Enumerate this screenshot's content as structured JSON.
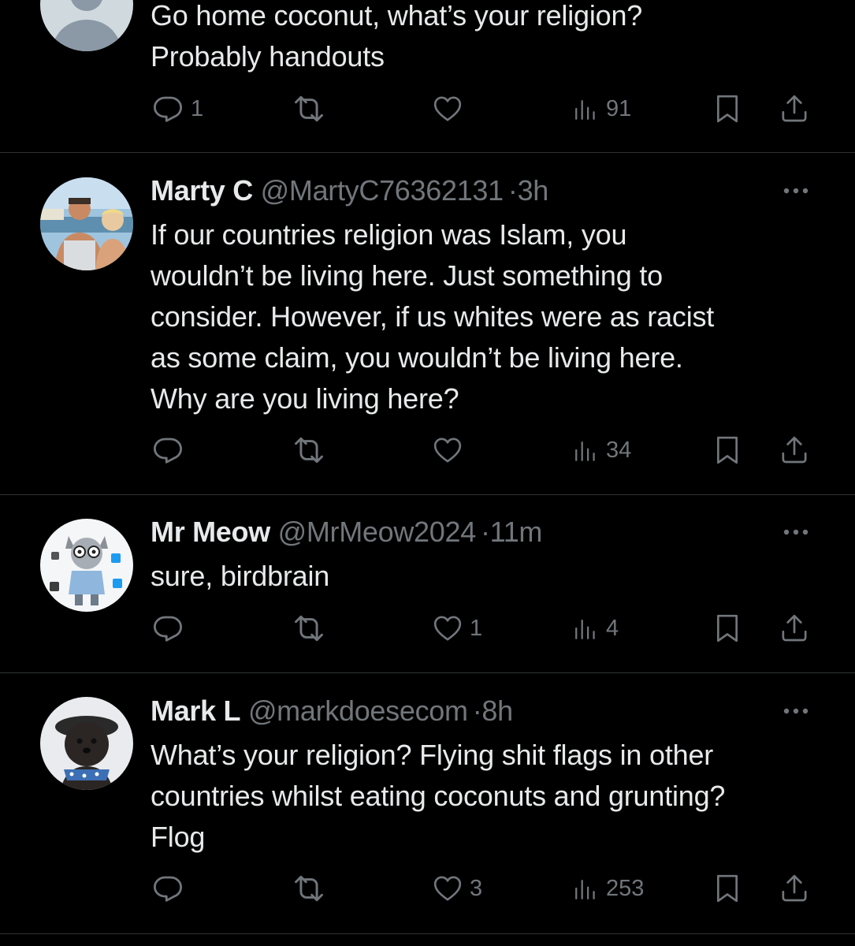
{
  "theme": {
    "background": "#000000",
    "primary_text": "#e7e9ea",
    "secondary_text": "#71767b",
    "divider": "#2f3336"
  },
  "icons": {
    "reply": "speech-bubble-icon",
    "retweet": "retweet-icon",
    "like": "heart-icon",
    "views": "bar-chart-icon",
    "bookmark": "bookmark-icon",
    "share": "share-upload-icon",
    "more": "more-dots-icon"
  },
  "tweets": [
    {
      "display_name": "",
      "text": "Go home coconut, what’s your religion?\nProbably handouts",
      "replies": "1",
      "retweets": "",
      "likes": "",
      "views": "91"
    },
    {
      "display_name": "Marty C",
      "handle": "@MartyC76362131",
      "separator": "·",
      "time": "3h",
      "text": "If our countries religion was Islam, you\nwouldn’t be living here. Just something to\nconsider. However, if us whites were as racist\nas some claim, you wouldn’t be living here.\nWhy are you living here?",
      "replies": "",
      "retweets": "",
      "likes": "",
      "views": "34"
    },
    {
      "display_name": "Mr Meow",
      "handle": "@MrMeow2024",
      "separator": "·",
      "time": "11m",
      "text": "sure, birdbrain",
      "replies": "",
      "retweets": "",
      "likes": "1",
      "views": "4"
    },
    {
      "display_name": "Mark L",
      "handle": "@markdoesecom",
      "separator": "·",
      "time": "8h",
      "text": "What’s your religion? Flying shit flags in other\ncountries whilst eating coconuts and grunting?\nFlog",
      "replies": "",
      "retweets": "",
      "likes": "3",
      "views": "253"
    }
  ]
}
